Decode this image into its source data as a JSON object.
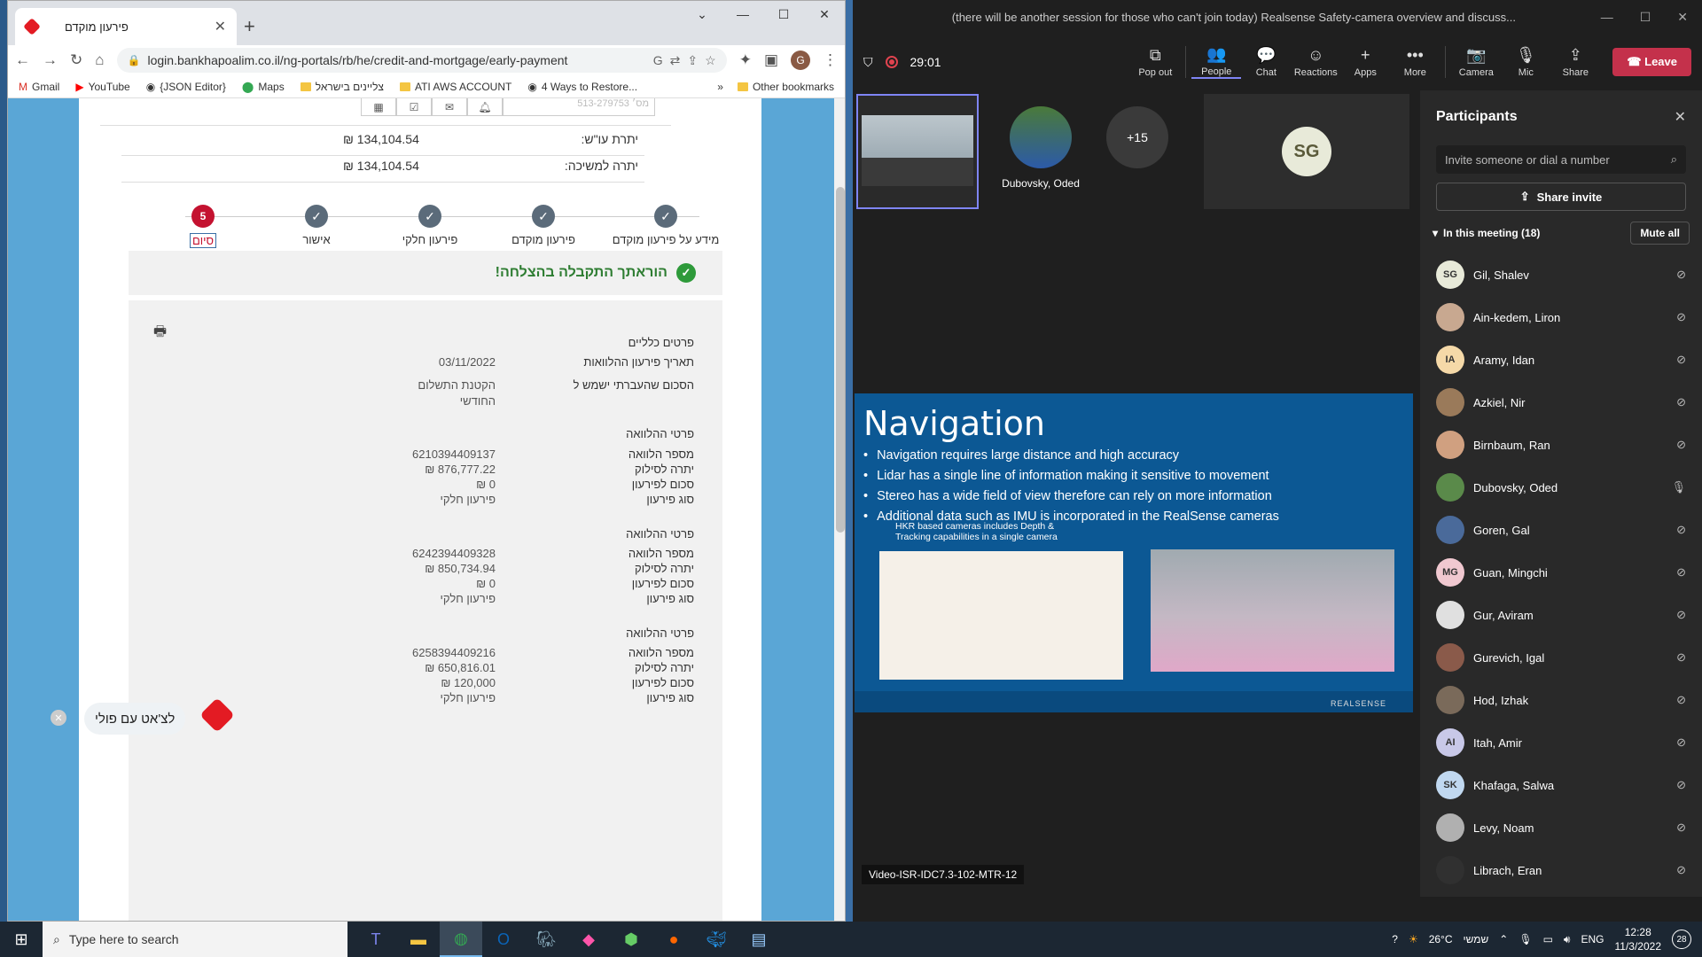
{
  "chrome": {
    "tab_title": "פירעון מוקדם",
    "url": "login.bankhapoalim.co.il/ng-portals/rb/he/credit-and-mortgage/early-payment",
    "profile_initial": "G",
    "bookmarks": [
      "Gmail",
      "YouTube",
      "{JSON Editor}",
      "Maps",
      "צליינים בישראל",
      "ATI AWS ACCOUNT",
      "4 Ways to Restore..."
    ],
    "other_bookmarks": "Other bookmarks",
    "chevron": "»"
  },
  "bank": {
    "account_placeholder": "מס׳ 513-279753",
    "balance_label": "יתרת עו\"ש:",
    "balance_value": "134,104.54 ₪",
    "withdraw_label": "יתרה למשיכה:",
    "withdraw_value": "134,104.54 ₪",
    "steps": [
      {
        "label": "מידע על פירעון מוקדם",
        "mark": "✓"
      },
      {
        "label": "פירעון מוקדם",
        "mark": "✓"
      },
      {
        "label": "פירעון חלקי",
        "mark": "✓"
      },
      {
        "label": "אישור",
        "mark": "✓"
      },
      {
        "label": "סיום",
        "mark": "5"
      }
    ],
    "success_msg": "הוראתך התקבלה בהצלחה!",
    "general_title": "פרטים כלליים",
    "date_label": "תאריך פירעון ההלוואות",
    "date_value": "03/11/2022",
    "amount_use_label": "הסכום שהעברתי ישמש ל",
    "amount_use_value_1": "הקטנת התשלום",
    "amount_use_value_2": "החודשי",
    "loans": [
      {
        "title": "פרטי ההלוואה",
        "number": "6210394409137",
        "balance": "876,777.22 ₪",
        "payoff": "0 ₪",
        "type": "פירעון חלקי"
      },
      {
        "title": "פרטי ההלוואה",
        "number": "6242394409328",
        "balance": "850,734.94 ₪",
        "payoff": "0 ₪",
        "type": "פירעון חלקי"
      },
      {
        "title": "פרטי ההלוואה",
        "number": "6258394409216",
        "balance": "650,816.01 ₪",
        "payoff": "120,000 ₪",
        "type": "פירעון חלקי"
      }
    ],
    "loan_labels": {
      "number": "מספר הלוואה",
      "balance": "יתרה לסילוק",
      "payoff": "סכום לפירעון",
      "type": "סוג פירעון"
    },
    "chat_label": "לצ'אט עם פולי"
  },
  "teams": {
    "title": "(there will be another session for those who can't join today) Realsense Safety-camera overview and discuss...",
    "timer": "29:01",
    "toolbar": [
      {
        "label": "Pop out",
        "icon": "⧉"
      },
      {
        "label": "People",
        "icon": "👥"
      },
      {
        "label": "Chat",
        "icon": "💬"
      },
      {
        "label": "Reactions",
        "icon": "☺"
      },
      {
        "label": "Apps",
        "icon": "+"
      },
      {
        "label": "More",
        "icon": "•••"
      }
    ],
    "media": [
      {
        "label": "Camera",
        "icon": "📷"
      },
      {
        "label": "Mic",
        "icon": "🎙"
      },
      {
        "label": "Share",
        "icon": "⇪"
      }
    ],
    "leave": "Leave",
    "tile_oded_name": "Dubovsky, Oded",
    "plus_count": "+15",
    "tile_sg": "SG",
    "slide": {
      "title": "Navigation",
      "bullets": [
        "Navigation requires large distance and high accuracy",
        "Lidar has a single line of information making it sensitive to movement",
        "Stereo has a wide field of view therefore can rely on more information",
        "Additional data such as IMU is incorporated in the RealSense cameras"
      ],
      "fig_caption_1": "HKR based cameras includes Depth &",
      "fig_caption_2": "Tracking capabilities in a single camera",
      "brand": "REALSENSE"
    },
    "room_label": "Video-ISR-IDC7.3-102-MTR-12",
    "panel_title": "Participants",
    "invite_placeholder": "Invite someone or dial a number",
    "share_invite": "Share invite",
    "in_meeting": "In this meeting (18)",
    "mute_all": "Mute all",
    "participants": [
      {
        "name": "Gil, Shalev",
        "initials": "SG",
        "color": "#e8ead9",
        "mic": "off"
      },
      {
        "name": "Ain-kedem, Liron",
        "initials": "",
        "color": "#c8a890",
        "mic": "off"
      },
      {
        "name": "Aramy, Idan",
        "initials": "IA",
        "color": "#f5d9a8",
        "mic": "off"
      },
      {
        "name": "Azkiel, Nir",
        "initials": "",
        "color": "#9a7a5a",
        "mic": "off"
      },
      {
        "name": "Birnbaum, Ran",
        "initials": "",
        "color": "#d0a080",
        "mic": "off"
      },
      {
        "name": "Dubovsky, Oded",
        "initials": "",
        "color": "#5a8a4a",
        "mic": "on"
      },
      {
        "name": "Goren, Gal",
        "initials": "",
        "color": "#4a6a9a",
        "mic": "off"
      },
      {
        "name": "Guan, Mingchi",
        "initials": "MG",
        "color": "#f0c8d0",
        "mic": "off"
      },
      {
        "name": "Gur, Aviram",
        "initials": "",
        "color": "#e0e0e0",
        "mic": "off"
      },
      {
        "name": "Gurevich, Igal",
        "initials": "",
        "color": "#8a5a4a",
        "mic": "off"
      },
      {
        "name": "Hod, Izhak",
        "initials": "",
        "color": "#7a6a5a",
        "mic": "off"
      },
      {
        "name": "Itah, Amir",
        "initials": "AI",
        "color": "#c8c8e8",
        "mic": "off"
      },
      {
        "name": "Khafaga, Salwa",
        "initials": "SK",
        "color": "#c0d8f0",
        "mic": "off"
      },
      {
        "name": "Levy, Noam",
        "initials": "",
        "color": "#b0b0b0",
        "mic": "off"
      },
      {
        "name": "Librach, Eran",
        "initials": "",
        "color": "#303030",
        "mic": "off"
      }
    ]
  },
  "taskbar": {
    "search_placeholder": "Type here to search",
    "weather": "26°C",
    "weather_label": "שמשי",
    "lang": "ENG",
    "time": "12:28",
    "date": "11/3/2022",
    "notif_count": "28"
  }
}
